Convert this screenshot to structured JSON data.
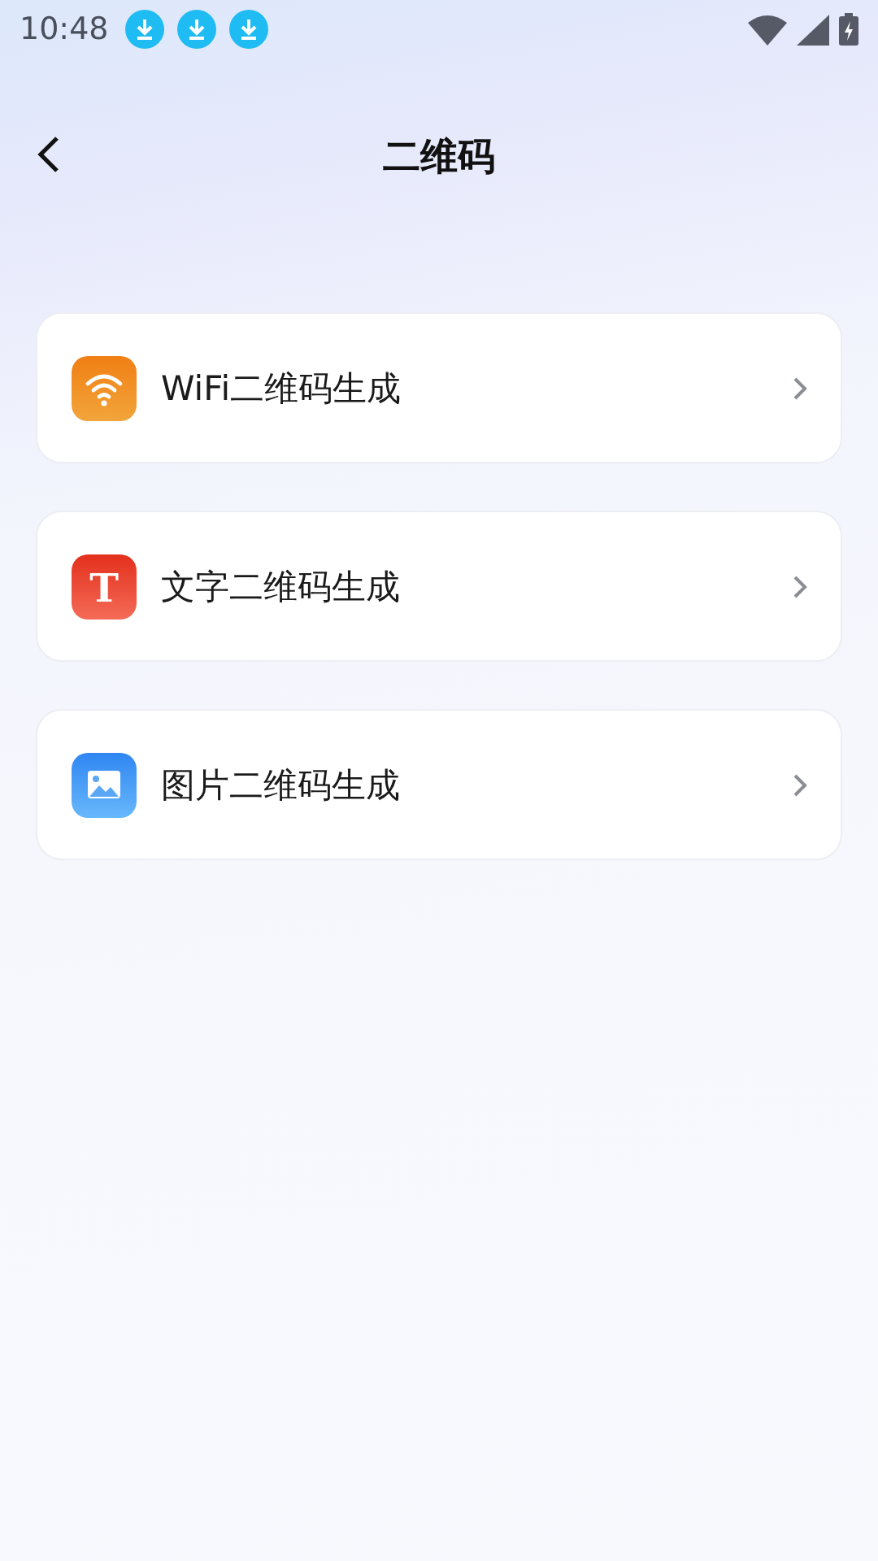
{
  "status_bar": {
    "time": "10:48",
    "notifications": [
      {
        "kind": "download"
      },
      {
        "kind": "download"
      },
      {
        "kind": "download"
      }
    ]
  },
  "header": {
    "title": "二维码"
  },
  "items": [
    {
      "kind": "wifi",
      "label": "WiFi二维码生成"
    },
    {
      "kind": "text",
      "label": "文字二维码生成",
      "icon_glyph": "T"
    },
    {
      "kind": "image",
      "label": "图片二维码生成"
    }
  ]
}
